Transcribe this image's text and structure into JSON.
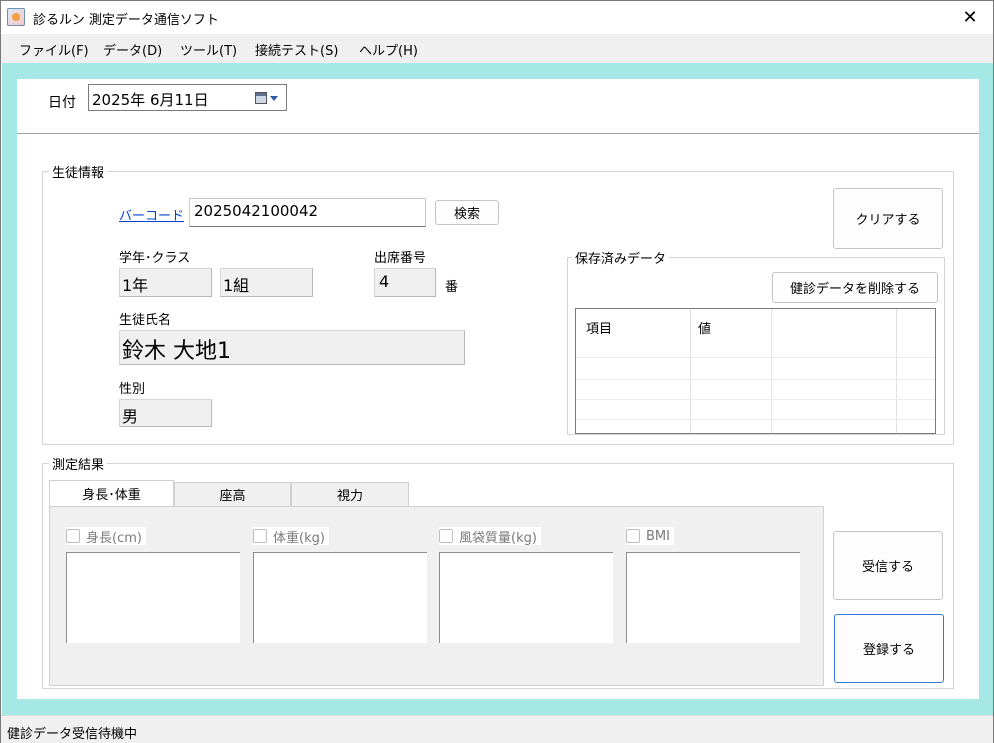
{
  "window": {
    "title": "診るルン 測定データ通信ソフト"
  },
  "menu": [
    "ファイル(F)",
    "データ(D)",
    "ツール(T)",
    "接続テスト(S)",
    "ヘルプ(H)"
  ],
  "date": {
    "label": "日付",
    "value": "2025年  6月11日"
  },
  "student": {
    "group_title": "生徒情報",
    "barcode_link": "バーコード",
    "barcode_value": "2025042100042",
    "search_button": "検索",
    "clear_button": "クリアする",
    "grade_class_label": "学年･クラス",
    "grade": "1年",
    "class": "1組",
    "attendance_label": "出席番号",
    "attendance": "4",
    "attendance_suffix": "番",
    "name_label": "生徒氏名",
    "name": "鈴木  大地1",
    "sex_label": "性別",
    "sex": "男"
  },
  "saved": {
    "group_title": "保存済みデータ",
    "delete_button": "健診データを削除する",
    "columns": [
      "項目",
      "値"
    ]
  },
  "measure": {
    "group_title": "測定結果",
    "tabs": [
      "身長･体重",
      "座高",
      "視力"
    ],
    "fields": [
      "身長(cm)",
      "体重(kg)",
      "風袋質量(kg)",
      "BMI"
    ],
    "receive_button": "受信する",
    "register_button": "登録する"
  },
  "status": "健診データ受信待機中"
}
